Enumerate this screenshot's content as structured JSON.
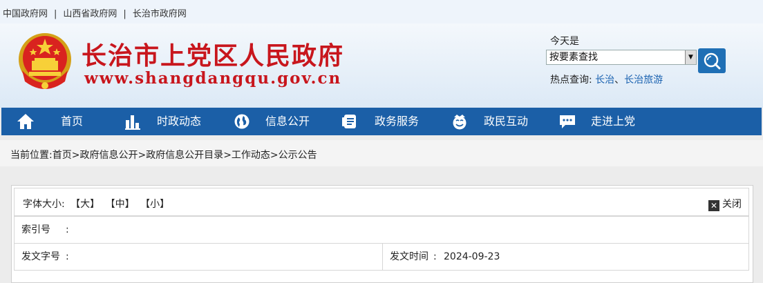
{
  "topbar": {
    "links": [
      "中国政府网",
      "山西省政府网",
      "长治市政府网"
    ],
    "separator": "|"
  },
  "header": {
    "title": "长治市上党区人民政府",
    "url": "www.shangdangqu.gov.cn",
    "today_label": "今天是",
    "search_select_value": "按要素查找",
    "hot_label": "热点查询:",
    "hot_links": [
      "长治",
      "长治旅游"
    ],
    "hot_sep": "、"
  },
  "nav": {
    "items": [
      {
        "label": "首页",
        "icon": "home-icon"
      },
      {
        "label": "时政动态",
        "icon": "chart-icon"
      },
      {
        "label": "信息公开",
        "icon": "globe-icon"
      },
      {
        "label": "政务服务",
        "icon": "document-icon"
      },
      {
        "label": "政民互动",
        "icon": "smile-icon"
      },
      {
        "label": "走进上党",
        "icon": "chat-icon"
      }
    ]
  },
  "breadcrumb": {
    "label": "当前位置:",
    "items": [
      "首页",
      "政府信息公开",
      "政府信息公开目录",
      "工作动态",
      "公示公告"
    ],
    "sep": ">"
  },
  "article": {
    "font_size_label": "字体大小:",
    "font_large": "【大】",
    "font_medium": "【中】",
    "font_small": "【小】",
    "close_label": "关闭",
    "index_label": "索引号",
    "index_colon": ":",
    "doc_no_label": "发文字号",
    "doc_no_colon": ":",
    "issue_time_label": "发文时间",
    "issue_time_colon": ":",
    "issue_time_value": "2024-09-23"
  },
  "colors": {
    "nav_bg": "#1b5fa7",
    "title_red": "#c8161d",
    "link_blue": "#1a62b0"
  }
}
